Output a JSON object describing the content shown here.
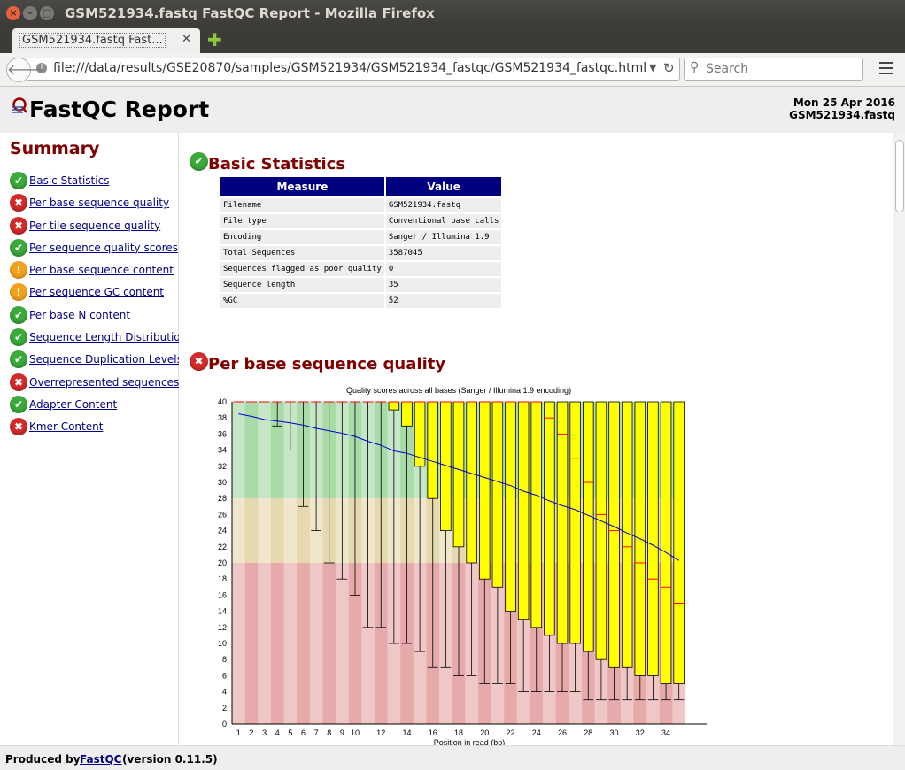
{
  "window": {
    "title": "GSM521934.fastq FastQC Report - Mozilla Firefox"
  },
  "tab": {
    "label": "GSM521934.fastq Fast...",
    "close": "✕"
  },
  "nav": {
    "url": "file:///data/results/GSE20870/samples/GSM521934/GSM521934_fastqc/GSM521934_fastqc.html",
    "search_placeholder": "Search"
  },
  "header": {
    "title": "FastQC Report",
    "date": "Mon 25 Apr 2016",
    "filename": "GSM521934.fastq"
  },
  "summary": {
    "title": "Summary",
    "modules": [
      {
        "label": "Basic Statistics",
        "status": "pass"
      },
      {
        "label": "Per base sequence quality",
        "status": "fail"
      },
      {
        "label": "Per tile sequence quality",
        "status": "fail"
      },
      {
        "label": "Per sequence quality scores",
        "status": "pass"
      },
      {
        "label": "Per base sequence content",
        "status": "warn"
      },
      {
        "label": "Per sequence GC content",
        "status": "warn"
      },
      {
        "label": "Per base N content",
        "status": "pass"
      },
      {
        "label": "Sequence Length Distribution",
        "status": "pass"
      },
      {
        "label": "Sequence Duplication Levels",
        "status": "pass"
      },
      {
        "label": "Overrepresented sequences",
        "status": "fail"
      },
      {
        "label": "Adapter Content",
        "status": "pass"
      },
      {
        "label": "Kmer Content",
        "status": "fail"
      }
    ]
  },
  "basic_stats": {
    "title": "Basic Statistics",
    "headers": [
      "Measure",
      "Value"
    ],
    "rows": [
      [
        "Filename",
        "GSM521934.fastq"
      ],
      [
        "File type",
        "Conventional base calls"
      ],
      [
        "Encoding",
        "Sanger / Illumina 1.9"
      ],
      [
        "Total Sequences",
        "3587045"
      ],
      [
        "Sequences flagged as poor quality",
        "0"
      ],
      [
        "Sequence length",
        "35"
      ],
      [
        "%GC",
        "52"
      ]
    ]
  },
  "per_base_quality": {
    "title": "Per base sequence quality"
  },
  "footer": {
    "prefix": "Produced by",
    "link": "FastQC",
    "version": "(version 0.11.5)"
  },
  "colors": {
    "good": "#a8dba8",
    "ok": "#e6d9b0",
    "bad": "#e6aaaa",
    "box": "#ffff00",
    "mean": "#0000cc",
    "median": "#ff0000"
  },
  "chart_data": {
    "type": "box",
    "title": "Quality scores across all bases (Sanger / Illumina 1.9 encoding)",
    "xlabel": "Position in read (bp)",
    "ylabel": "",
    "ylim": [
      0,
      40
    ],
    "yticks": [
      0,
      2,
      4,
      6,
      8,
      10,
      12,
      14,
      16,
      18,
      20,
      22,
      24,
      26,
      28,
      30,
      32,
      34,
      36,
      38,
      40
    ],
    "xtick_labels": [
      "1",
      "2",
      "3",
      "4",
      "5",
      "6",
      "7",
      "8",
      "9",
      "10",
      "12",
      "14",
      "16",
      "18",
      "20",
      "22",
      "24",
      "26",
      "28",
      "30",
      "32",
      "34"
    ],
    "positions": [
      1,
      2,
      3,
      4,
      5,
      6,
      7,
      8,
      9,
      10,
      11,
      12,
      13,
      14,
      15,
      16,
      17,
      18,
      19,
      20,
      21,
      22,
      23,
      24,
      25,
      26,
      27,
      28,
      29,
      30,
      31,
      32,
      33,
      34,
      35
    ],
    "q1": [
      40,
      40,
      40,
      40,
      40,
      40,
      40,
      40,
      40,
      40,
      40,
      40,
      39,
      37,
      32,
      28,
      24,
      22,
      20,
      18,
      17,
      14,
      13,
      12,
      11,
      10,
      10,
      9,
      8,
      7,
      7,
      6,
      6,
      5,
      5
    ],
    "median": [
      40,
      40,
      40,
      40,
      40,
      40,
      40,
      40,
      40,
      40,
      40,
      40,
      40,
      40,
      40,
      40,
      40,
      40,
      40,
      40,
      40,
      40,
      40,
      40,
      38,
      36,
      33,
      30,
      26,
      24,
      22,
      20,
      18,
      17,
      15
    ],
    "q3": [
      40,
      40,
      40,
      40,
      40,
      40,
      40,
      40,
      40,
      40,
      40,
      40,
      40,
      40,
      40,
      40,
      40,
      40,
      40,
      40,
      40,
      40,
      40,
      40,
      40,
      40,
      40,
      40,
      40,
      40,
      40,
      40,
      40,
      40,
      40
    ],
    "p10": [
      40,
      40,
      40,
      37,
      34,
      27,
      24,
      20,
      18,
      16,
      12,
      12,
      10,
      10,
      9,
      7,
      7,
      6,
      6,
      5,
      5,
      5,
      4,
      4,
      4,
      4,
      4,
      3,
      3,
      3,
      3,
      3,
      3,
      3,
      3
    ],
    "p90": [
      40,
      40,
      40,
      40,
      40,
      40,
      40,
      40,
      40,
      40,
      40,
      40,
      40,
      40,
      40,
      40,
      40,
      40,
      40,
      40,
      40,
      40,
      40,
      40,
      40,
      40,
      40,
      40,
      40,
      40,
      40,
      40,
      40,
      40,
      40
    ],
    "mean": [
      38.5,
      38.2,
      37.8,
      37.6,
      37.4,
      37.1,
      36.7,
      36.4,
      36.1,
      35.7,
      35.1,
      34.6,
      33.9,
      33.6,
      33.1,
      32.6,
      32.1,
      31.6,
      31.1,
      30.6,
      30.1,
      29.6,
      28.9,
      28.4,
      27.7,
      27.1,
      26.6,
      25.9,
      25.2,
      24.5,
      23.7,
      23.0,
      22.2,
      21.3,
      20.3
    ]
  }
}
